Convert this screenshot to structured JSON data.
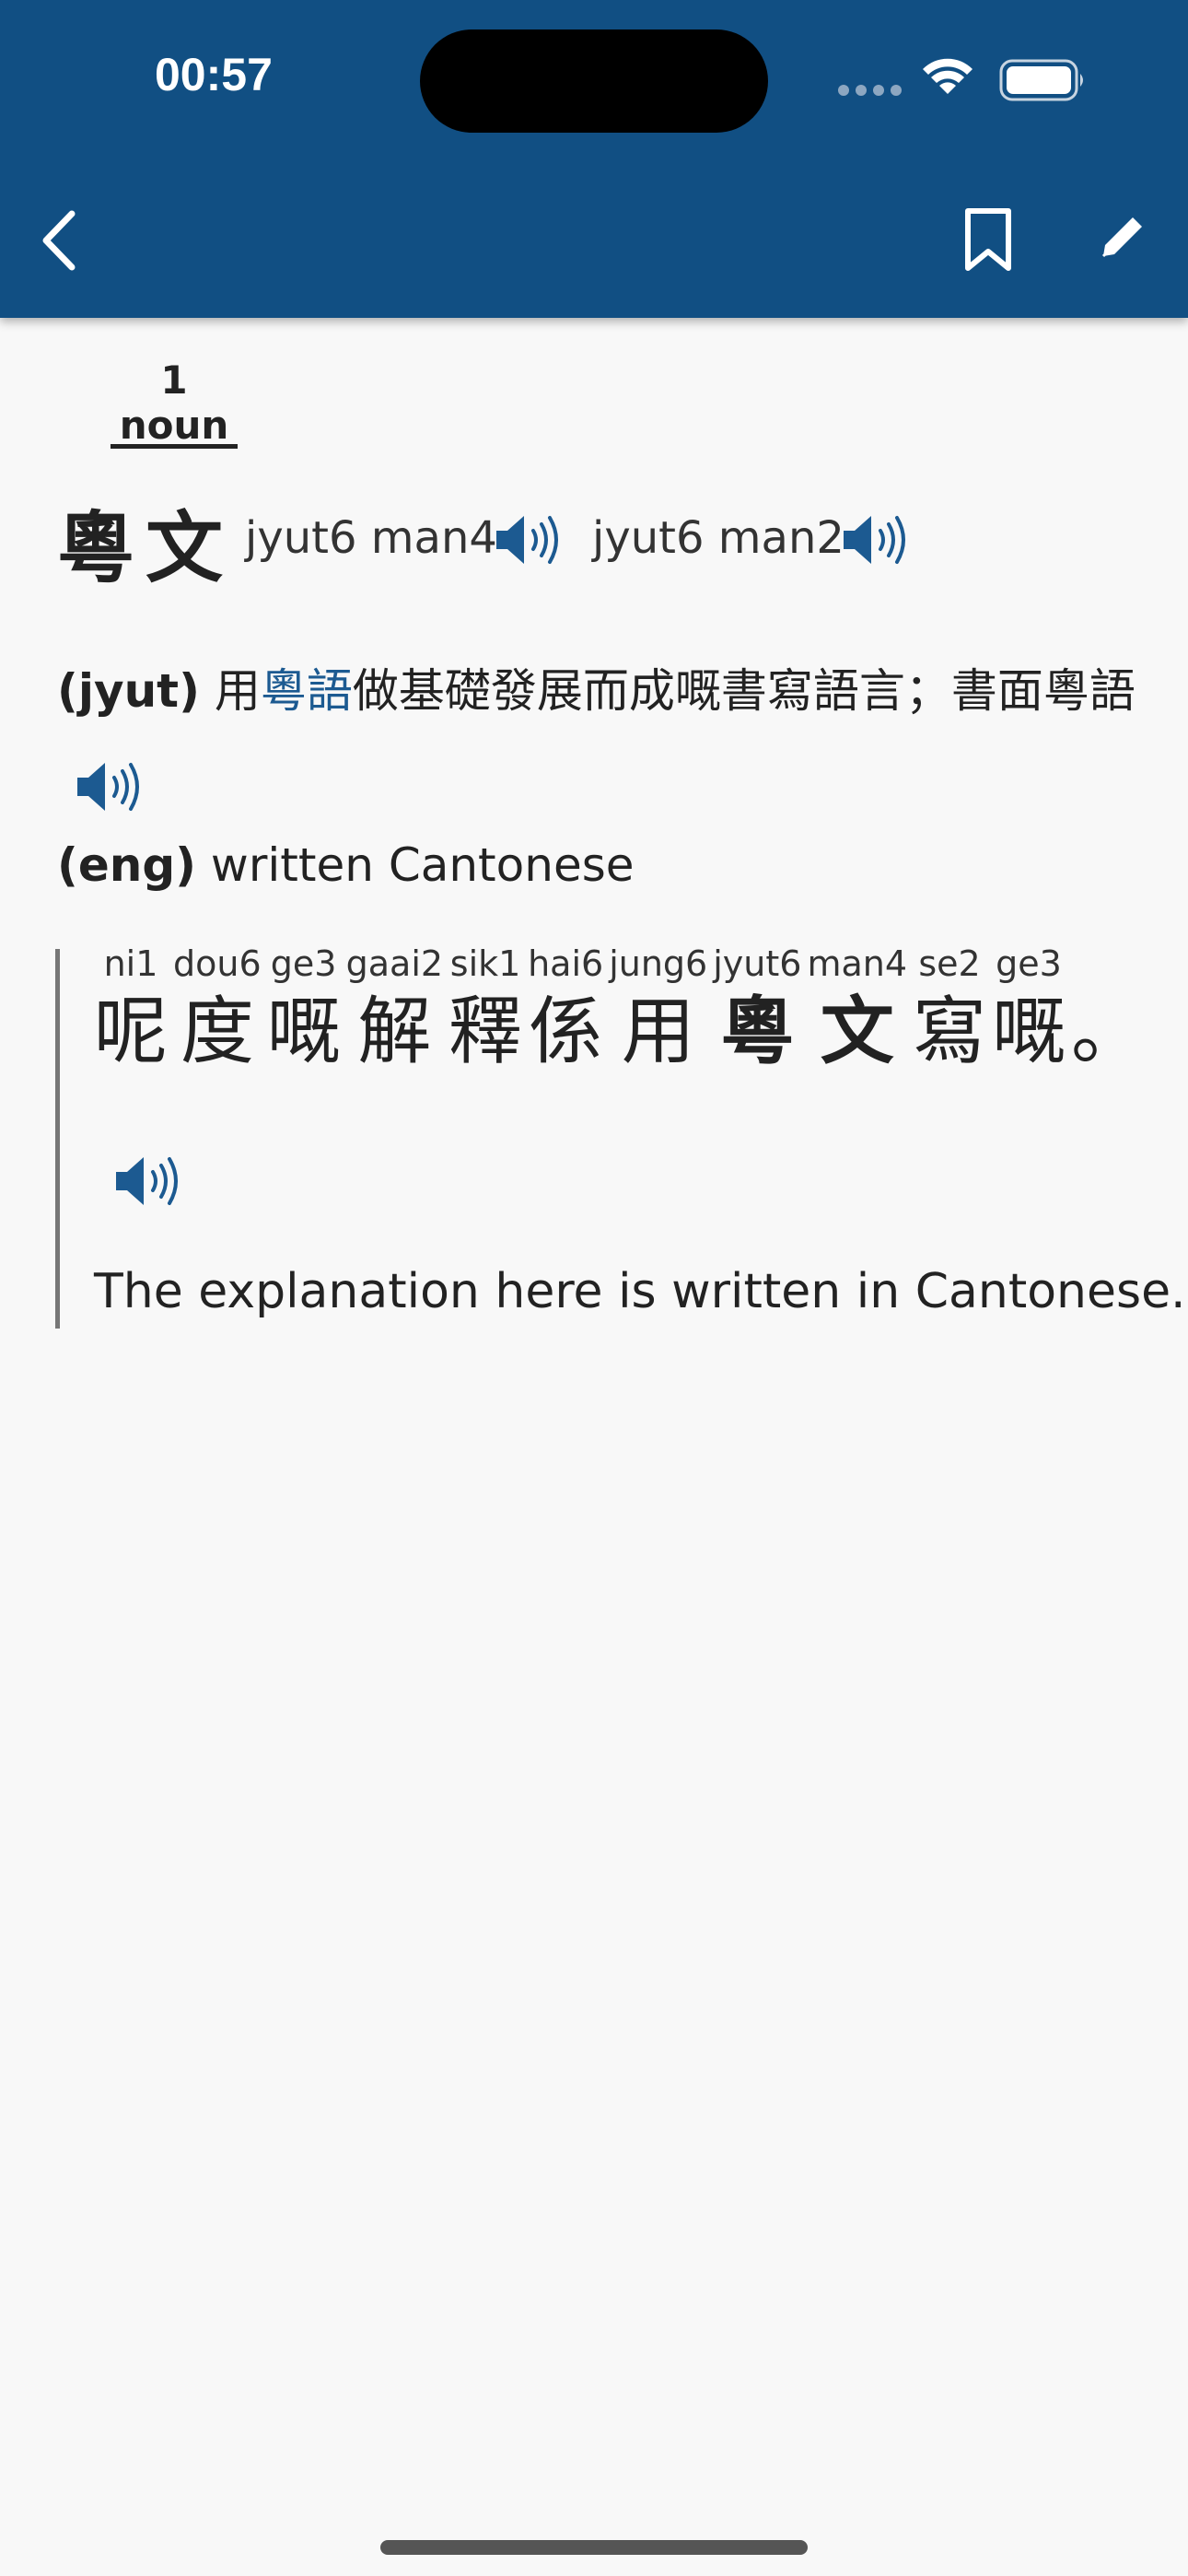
{
  "status_bar": {
    "time": "00:57"
  },
  "header": {
    "back_icon": "chevron-left-icon",
    "bookmark_icon": "bookmark-icon",
    "edit_icon": "pencil-icon",
    "background_color": "#114f83"
  },
  "tabs": [
    {
      "label": "1 noun",
      "active": true
    }
  ],
  "entry": {
    "headword": "粵文",
    "pronunciations": [
      {
        "jyutping": "jyut6 man4"
      },
      {
        "jyutping": "jyut6 man2"
      }
    ],
    "definition_yue": {
      "lang": "(jyut)",
      "prefix": "用",
      "link": "粵語",
      "suffix": "做基礎發展而成嘅書寫語言；書面粵語"
    },
    "definition_eng": {
      "lang": "(eng)",
      "text": "written Cantonese"
    },
    "example": {
      "characters": [
        {
          "jyutping": "ni1",
          "char": "呢",
          "bold": false
        },
        {
          "jyutping": "dou6",
          "char": "度",
          "bold": false
        },
        {
          "jyutping": "ge3",
          "char": "嘅",
          "bold": false
        },
        {
          "jyutping": "gaai2",
          "char": "解",
          "bold": false
        },
        {
          "jyutping": "sik1",
          "char": "釋",
          "bold": false
        },
        {
          "jyutping": "hai6",
          "char": "係",
          "bold": false
        },
        {
          "jyutping": "jung6",
          "char": "用",
          "bold": false
        },
        {
          "jyutping": "jyut6",
          "char": "粵",
          "bold": true
        },
        {
          "jyutping": "man4",
          "char": "文",
          "bold": true
        },
        {
          "jyutping": "se2",
          "char": "寫",
          "bold": false
        },
        {
          "jyutping": "ge3",
          "char": "嘅",
          "bold": false
        },
        {
          "jyutping": "",
          "char": "。",
          "bold": false
        }
      ],
      "translation": "The explanation here is written in Cantonese."
    }
  },
  "accent_color": "#1c5a91"
}
